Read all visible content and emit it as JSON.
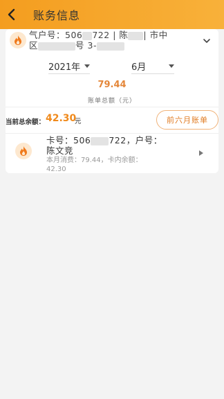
{
  "header": {
    "title": "账务信息"
  },
  "account": {
    "line1": "气户号：506",
    "line1b": "722 | 陈",
    "line1c": "| 市中",
    "line2": "区",
    "line2b": "号  3-"
  },
  "filters": {
    "year": "2021年",
    "month": "6月"
  },
  "bill": {
    "total": "79.44",
    "total_label": "账单总额（元）"
  },
  "balance": {
    "label": "当前总余额：",
    "value": "42.30",
    "unit": "元",
    "history_button": "前六月账单"
  },
  "card": {
    "number_prefix": "卡号：506",
    "number_suffix": "722，户号：",
    "name": "陈文竞",
    "usage": "本月消费：79.44，卡内余额：",
    "balance": "42.30"
  },
  "colors": {
    "accent": "#f49d1f",
    "amount": "#f08a1c"
  }
}
